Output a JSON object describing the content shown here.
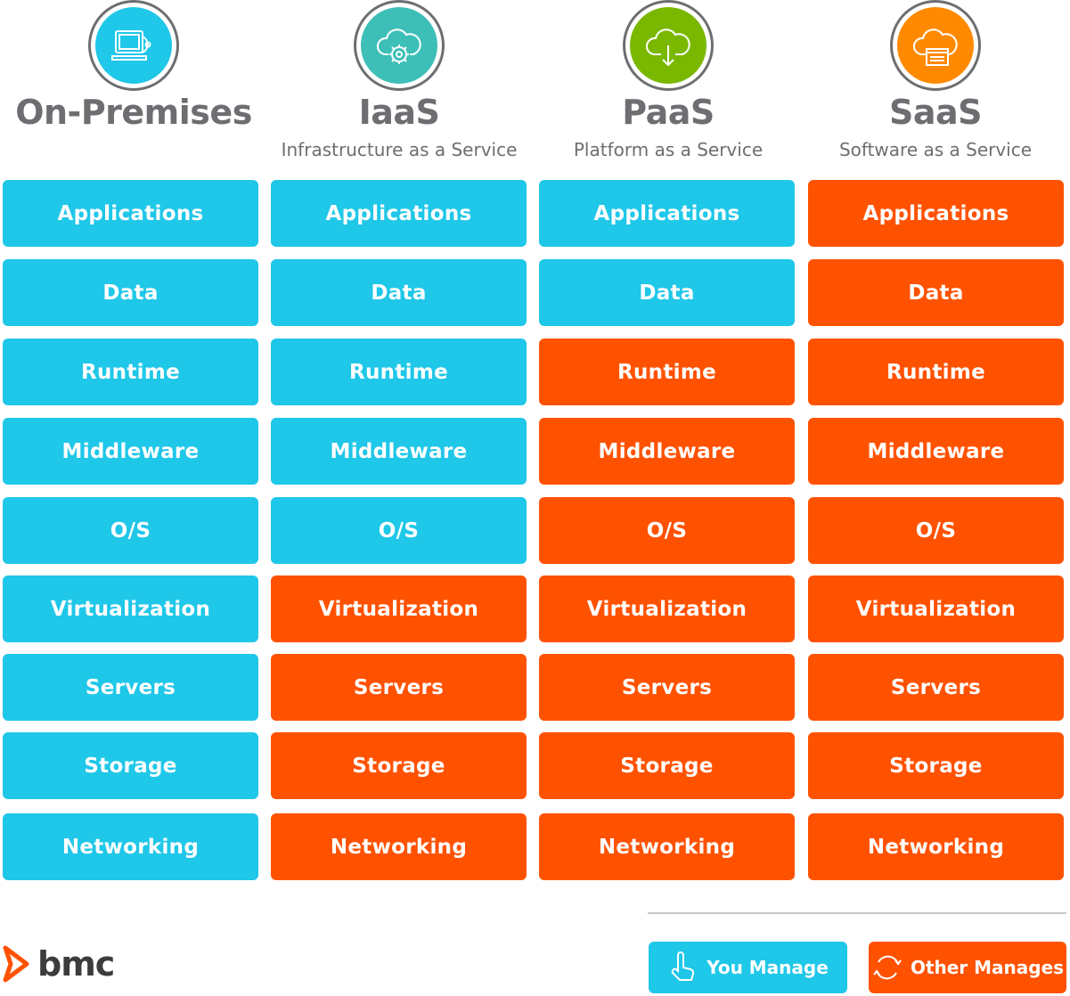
{
  "columns": [
    {
      "title": "On-Premises",
      "subtitle": "",
      "icon": "laptop-disc-icon",
      "icon_color": "#1fc7e8"
    },
    {
      "title": "IaaS",
      "subtitle": "Infrastructure as a Service",
      "icon": "cloud-gear-icon",
      "icon_color": "#3dbfb8"
    },
    {
      "title": "PaaS",
      "subtitle": "Platform as a Service",
      "icon": "cloud-download-icon",
      "icon_color": "#7ab800"
    },
    {
      "title": "SaaS",
      "subtitle": "Software as a Service",
      "icon": "cloud-window-icon",
      "icon_color": "#ff8a00"
    }
  ],
  "layers": [
    "Applications",
    "Data",
    "Runtime",
    "Middleware",
    "O/S",
    "Virtualization",
    "Servers",
    "Storage",
    "Networking"
  ],
  "managed_by": [
    [
      "you",
      "you",
      "you",
      "you",
      "you",
      "you",
      "you",
      "you",
      "you"
    ],
    [
      "you",
      "you",
      "you",
      "you",
      "you",
      "other",
      "other",
      "other",
      "other"
    ],
    [
      "you",
      "you",
      "other",
      "other",
      "other",
      "other",
      "other",
      "other",
      "other"
    ],
    [
      "other",
      "other",
      "other",
      "other",
      "other",
      "other",
      "other",
      "other",
      "other"
    ]
  ],
  "legend": {
    "you_manage": {
      "label": "You Manage",
      "icon": "hand-pointer-icon",
      "color": "#1fc7e8"
    },
    "other_manages": {
      "label": "Other Manages",
      "icon": "refresh-cycle-icon",
      "color": "#ff5200"
    }
  },
  "logo": {
    "text": "bmc",
    "color": "#ff5200"
  }
}
